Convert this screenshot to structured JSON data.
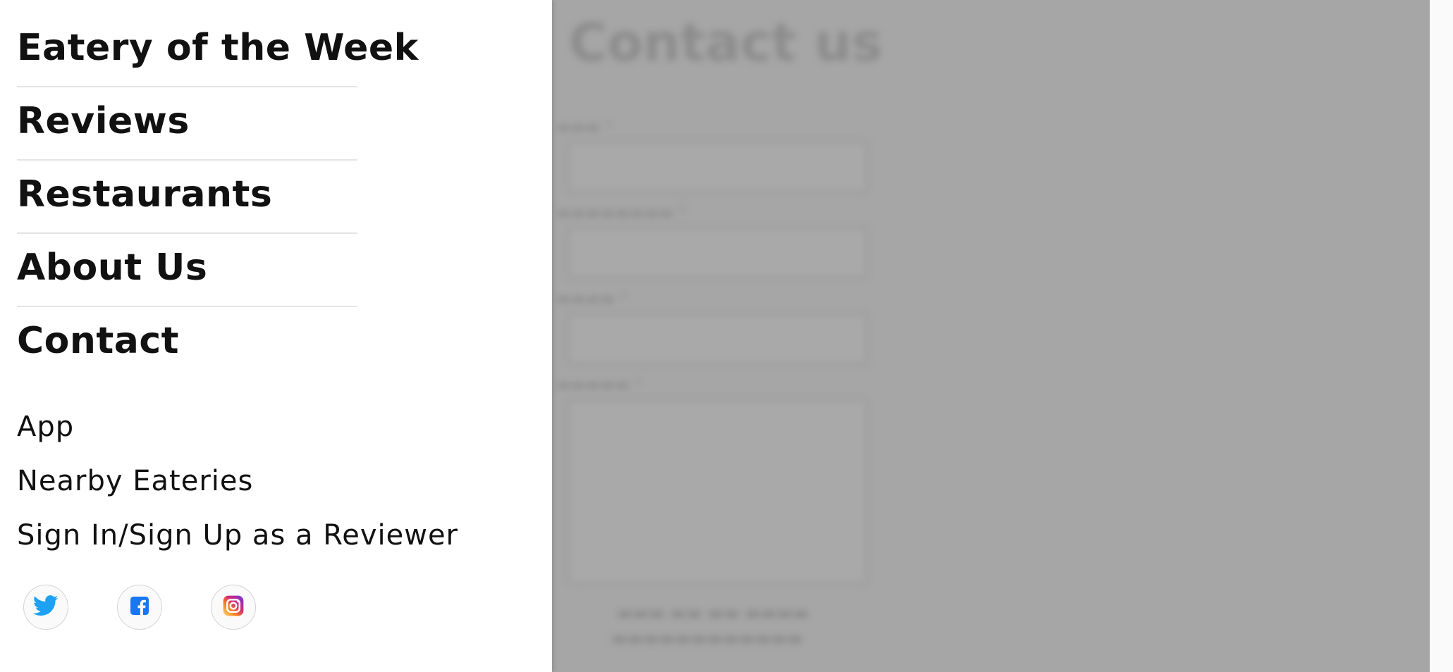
{
  "nav": {
    "primary": [
      {
        "label": "Eatery of the Week"
      },
      {
        "label": "Reviews"
      },
      {
        "label": "Restaurants"
      },
      {
        "label": "About Us"
      },
      {
        "label": "Contact"
      }
    ],
    "secondary": [
      {
        "label": "App"
      },
      {
        "label": "Nearby Eateries"
      },
      {
        "label": "Sign In/Sign Up as a Reviewer"
      }
    ]
  },
  "social": [
    {
      "icon": "twitter-icon",
      "color": "#1da1f2"
    },
    {
      "icon": "facebook-icon",
      "color": "#1877f2"
    },
    {
      "icon": "instagram-icon",
      "color": "#e1306c"
    }
  ],
  "background": {
    "title": "Contact us",
    "overlay_color": "#a6a6a6"
  }
}
